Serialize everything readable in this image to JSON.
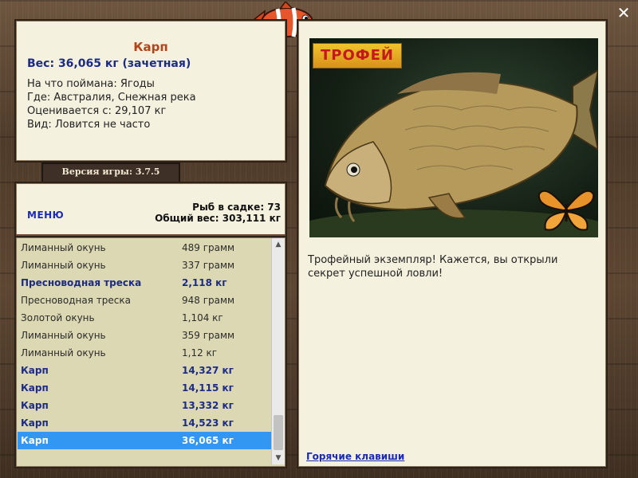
{
  "info": {
    "name": "Карп",
    "weight": "Вес: 36,065 кг (зачетная)",
    "caught_on": "На что поймана: Ягоды",
    "where": "Где: Австралия, Снежная река",
    "value": "Оценивается с: 29,107 кг",
    "kind": "Вид: Ловится не часто"
  },
  "version_label": "Версия игры: 3.7.5",
  "summary": {
    "menu_label": "МЕНЮ",
    "fish_count": "Рыб в садке: 73",
    "total_weight": "Общий вес: 303,111 кг"
  },
  "catch_list": [
    {
      "name": "Лиманный окунь",
      "weight": "489 грамм",
      "trophy": false
    },
    {
      "name": "Лиманный окунь",
      "weight": "337 грамм",
      "trophy": false
    },
    {
      "name": "Пресноводная треска",
      "weight": "2,118 кг",
      "trophy": true
    },
    {
      "name": "Пресноводная треска",
      "weight": "948 грамм",
      "trophy": false
    },
    {
      "name": "Золотой окунь",
      "weight": "1,104 кг",
      "trophy": false
    },
    {
      "name": "Лиманный окунь",
      "weight": "359 грамм",
      "trophy": false
    },
    {
      "name": "Лиманный окунь",
      "weight": "1,12 кг",
      "trophy": false
    },
    {
      "name": "Карп",
      "weight": "14,327 кг",
      "trophy": true
    },
    {
      "name": "Карп",
      "weight": "14,115 кг",
      "trophy": true
    },
    {
      "name": "Карп",
      "weight": "13,332 кг",
      "trophy": true
    },
    {
      "name": "Карп",
      "weight": "14,523 кг",
      "trophy": true
    },
    {
      "name": "Карп",
      "weight": "36,065 кг",
      "trophy": true,
      "selected": true
    }
  ],
  "trophy": {
    "badge": "ТРОФЕЙ",
    "message": "Трофейный экземпляр! Кажется, вы открыли секрет успешной ловли!",
    "hotkeys_label": "Горячие клавиши"
  },
  "colors": {
    "trophy_text": "#1c2b86",
    "selected_bg": "#3296f3",
    "fish_name": "#b3441a"
  },
  "icons": {
    "close": "close-icon",
    "scroll_up": "chevron-up-icon",
    "scroll_down": "chevron-down-icon",
    "logo": "clownfish-logo-icon",
    "butterfly": "butterfly-icon"
  }
}
